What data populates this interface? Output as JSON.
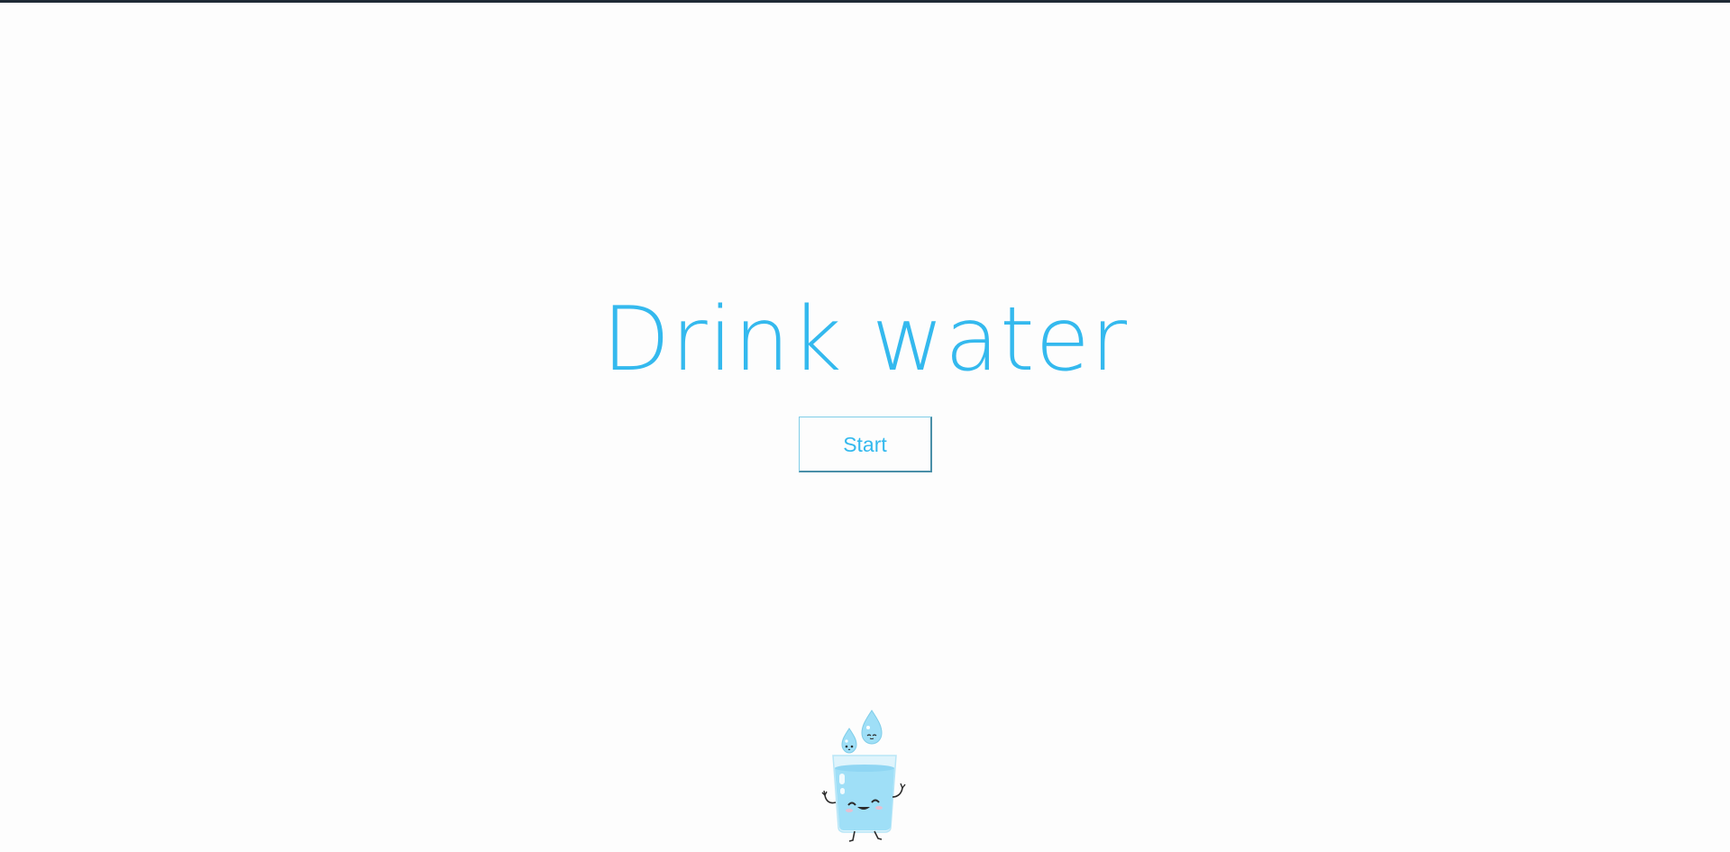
{
  "page": {
    "title": "Drink water",
    "start_button_label": "Start"
  },
  "illustration": {
    "icon": "water-glass-mascot-icon"
  },
  "colors": {
    "accent": "#34b9ee",
    "background": "#fdfdfd",
    "top_bar": "#1f2a36",
    "water": "#9fdff7"
  }
}
